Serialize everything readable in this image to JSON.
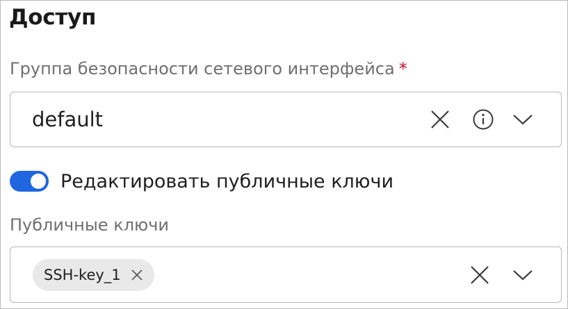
{
  "section": {
    "title": "Доступ"
  },
  "security_group": {
    "label": "Группа безопасности сетевого интерфейса",
    "required_mark": "*",
    "value": "default",
    "icons": [
      "close-icon",
      "info-icon",
      "chevron-down-icon"
    ]
  },
  "toggle": {
    "label": "Редактировать публичные ключи",
    "state": "on",
    "accent_color": "#1f66e0"
  },
  "public_keys": {
    "label": "Публичные ключи",
    "chips": [
      {
        "label": "SSH-key_1"
      }
    ],
    "icons": [
      "close-icon",
      "chevron-down-icon"
    ]
  },
  "colors": {
    "required": "#c8102e",
    "label": "#6f6f6f",
    "border": "#b6b6b6"
  }
}
